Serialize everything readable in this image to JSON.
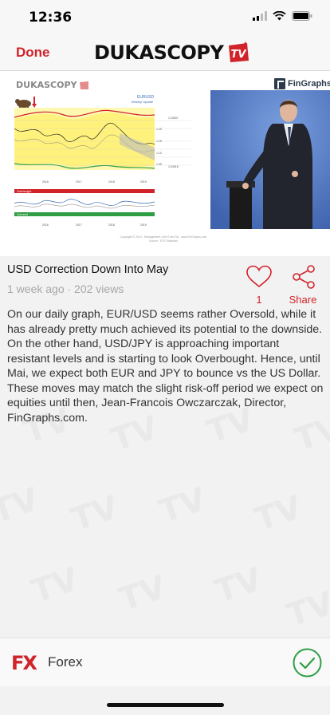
{
  "status_bar": {
    "time": "12:36",
    "icons": [
      "signal-icon",
      "wifi-icon",
      "battery-icon"
    ]
  },
  "nav": {
    "done_label": "Done",
    "brand": "DUKASCOPY",
    "brand_badge": "TV"
  },
  "media": {
    "chart_logo": "DUKASCOPY",
    "chart_title": "EURUSD",
    "chart_subtitle": "Weekly Update",
    "overbought_label": "Overbought",
    "oversold_label": "Oversold",
    "price_levels": [
      "1.23637",
      "1.20",
      "1.15",
      "1.10",
      "1.05",
      "1.04918"
    ],
    "x_ticks": [
      "2016",
      "2017",
      "2018",
      "2019"
    ],
    "copyright": "Copyright © 2013 - Management Joint Third SA - www.FinGraphs.com",
    "source": "Source : ECF Statistics",
    "partner": "FinGraphs"
  },
  "video": {
    "title": "USD Correction Down Into May",
    "meta": "1 week ago · 202 views",
    "likes": "1",
    "share_label": "Share",
    "description": "On our daily graph, EUR/USD seems rather Oversold, while it has already pretty much achieved its potential to the downside. On the other hand, USD/JPY is approaching important resistant levels and is starting to look Overbought. Hence, until Mai, we expect both EUR and JPY to bounce vs the US Dollar. These moves may match the slight risk-off period we expect on equities until then, Jean-Francois Owczarczak, Director, FinGraphs.com."
  },
  "footer": {
    "logo": "FX",
    "category": "Forex"
  },
  "colors": {
    "accent": "#d0232a",
    "check": "#2e9e44",
    "background": "#f2f2f2"
  }
}
